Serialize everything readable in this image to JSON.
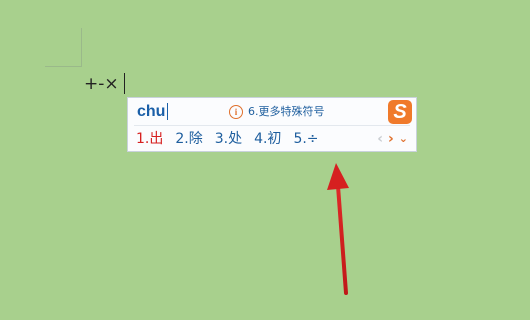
{
  "document": {
    "typed_text": "+-×"
  },
  "ime": {
    "pinyin": "chu",
    "hint": "6.更多特殊符号",
    "logo": "S",
    "candidates": [
      "1.出",
      "2.除",
      "3.处",
      "4.初",
      "5.÷"
    ],
    "nav": {
      "prev": "‹",
      "next": "›",
      "expand": "⌄"
    }
  },
  "colors": {
    "background": "#a8d08d",
    "selected_candidate": "#d62020",
    "candidate": "#1e5e9e",
    "accent": "#e0702c",
    "annotation_arrow": "#d62020"
  }
}
